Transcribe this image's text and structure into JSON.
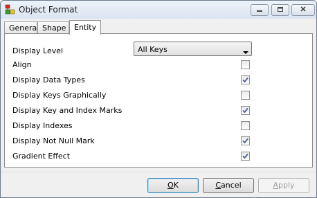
{
  "window": {
    "title": "Object Format"
  },
  "titlebar_buttons": {
    "minimize": "minimize-icon",
    "maximize": "maximize-icon",
    "close": "close-icon"
  },
  "tabs": [
    {
      "label": "General"
    },
    {
      "label": "Shape"
    },
    {
      "label": "Entity",
      "active": true
    }
  ],
  "display_level": {
    "label": "Display Level",
    "value": "All Keys"
  },
  "options": [
    {
      "label": "Align",
      "checked": false
    },
    {
      "label": "Display Data Types",
      "checked": true
    },
    {
      "label": "Display Keys Graphically",
      "checked": false
    },
    {
      "label": "Display Key and Index Marks",
      "checked": true
    },
    {
      "label": "Display Indexes",
      "checked": false
    },
    {
      "label": "Display Not Null Mark",
      "checked": true
    },
    {
      "label": "Gradient Effect",
      "checked": true
    }
  ],
  "buttons": {
    "ok": {
      "mnemonic": "O",
      "rest": "K"
    },
    "cancel": {
      "mnemonic": "C",
      "rest": "ancel"
    },
    "apply": {
      "mnemonic": "A",
      "rest": "pply",
      "disabled": true
    }
  }
}
